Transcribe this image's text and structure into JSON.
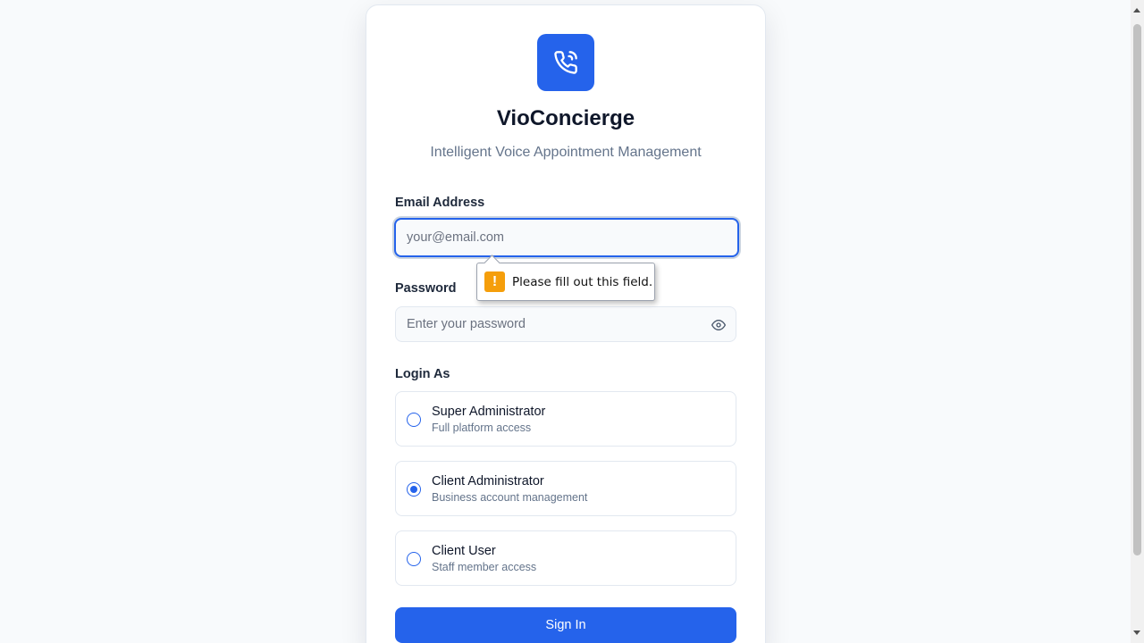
{
  "app": {
    "title": "VioConcierge",
    "subtitle": "Intelligent Voice Appointment Management",
    "brand_color": "#2563eb",
    "logo_icon": "phone-signal-icon"
  },
  "form": {
    "email": {
      "label": "Email Address",
      "placeholder": "your@email.com",
      "value": ""
    },
    "password": {
      "label": "Password",
      "placeholder": "Enter your password",
      "value": "",
      "toggle_icon": "eye-icon"
    },
    "login_as": {
      "label": "Login As",
      "options": [
        {
          "title": "Super Administrator",
          "description": "Full platform access",
          "selected": false
        },
        {
          "title": "Client Administrator",
          "description": "Business account management",
          "selected": true
        },
        {
          "title": "Client User",
          "description": "Staff member access",
          "selected": false
        }
      ]
    },
    "submit_label": "Sign In"
  },
  "validation": {
    "message": "Please fill out this field.",
    "icon": "warning-icon",
    "icon_color": "#f59e0b"
  }
}
